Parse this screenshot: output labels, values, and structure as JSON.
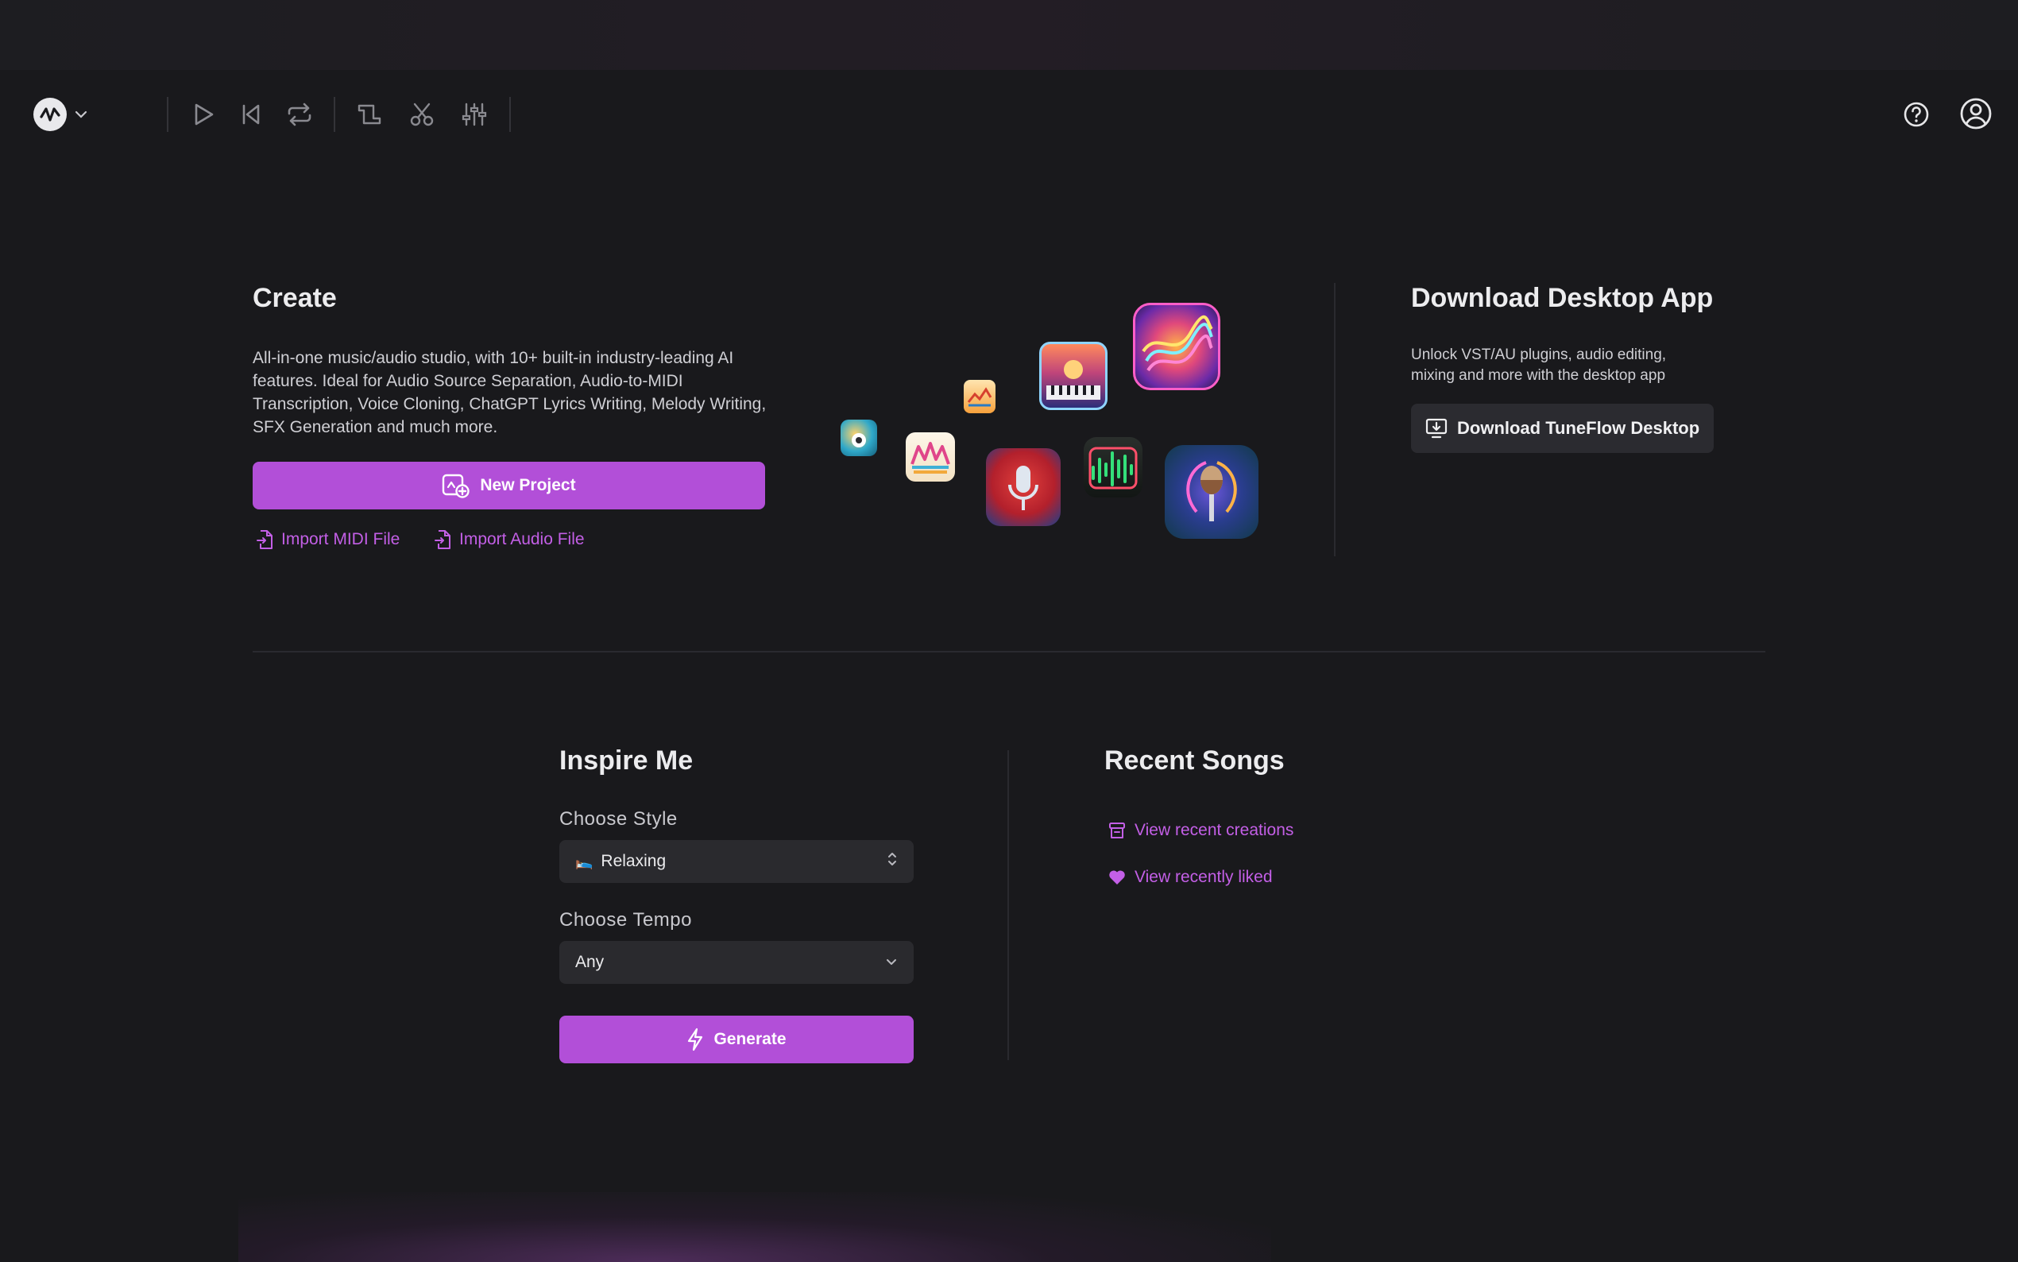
{
  "create": {
    "title": "Create",
    "description": "All-in-one music/audio studio, with 10+ built-in industry-leading AI features. Ideal for Audio Source Separation, Audio-to-MIDI Transcription, Voice Cloning, ChatGPT Lyrics Writing, Melody Writing, SFX Generation and much more.",
    "new_project_label": "New Project",
    "import_midi_label": "Import MIDI File",
    "import_audio_label": "Import Audio File"
  },
  "desktop": {
    "title": "Download Desktop App",
    "description": "Unlock VST/AU plugins, audio editing, mixing and more with the desktop app",
    "download_label": "Download TuneFlow Desktop"
  },
  "inspire": {
    "title": "Inspire Me",
    "style_label": "Choose Style",
    "style_value": "Relaxing",
    "style_emoji": "🛌",
    "tempo_label": "Choose Tempo",
    "tempo_value": "Any",
    "generate_label": "Generate"
  },
  "recent": {
    "title": "Recent Songs",
    "view_creations_label": "View recent creations",
    "view_liked_label": "View recently liked"
  },
  "colors": {
    "accent": "#b24fd8",
    "link": "#c35fe6",
    "background": "#19191c"
  }
}
